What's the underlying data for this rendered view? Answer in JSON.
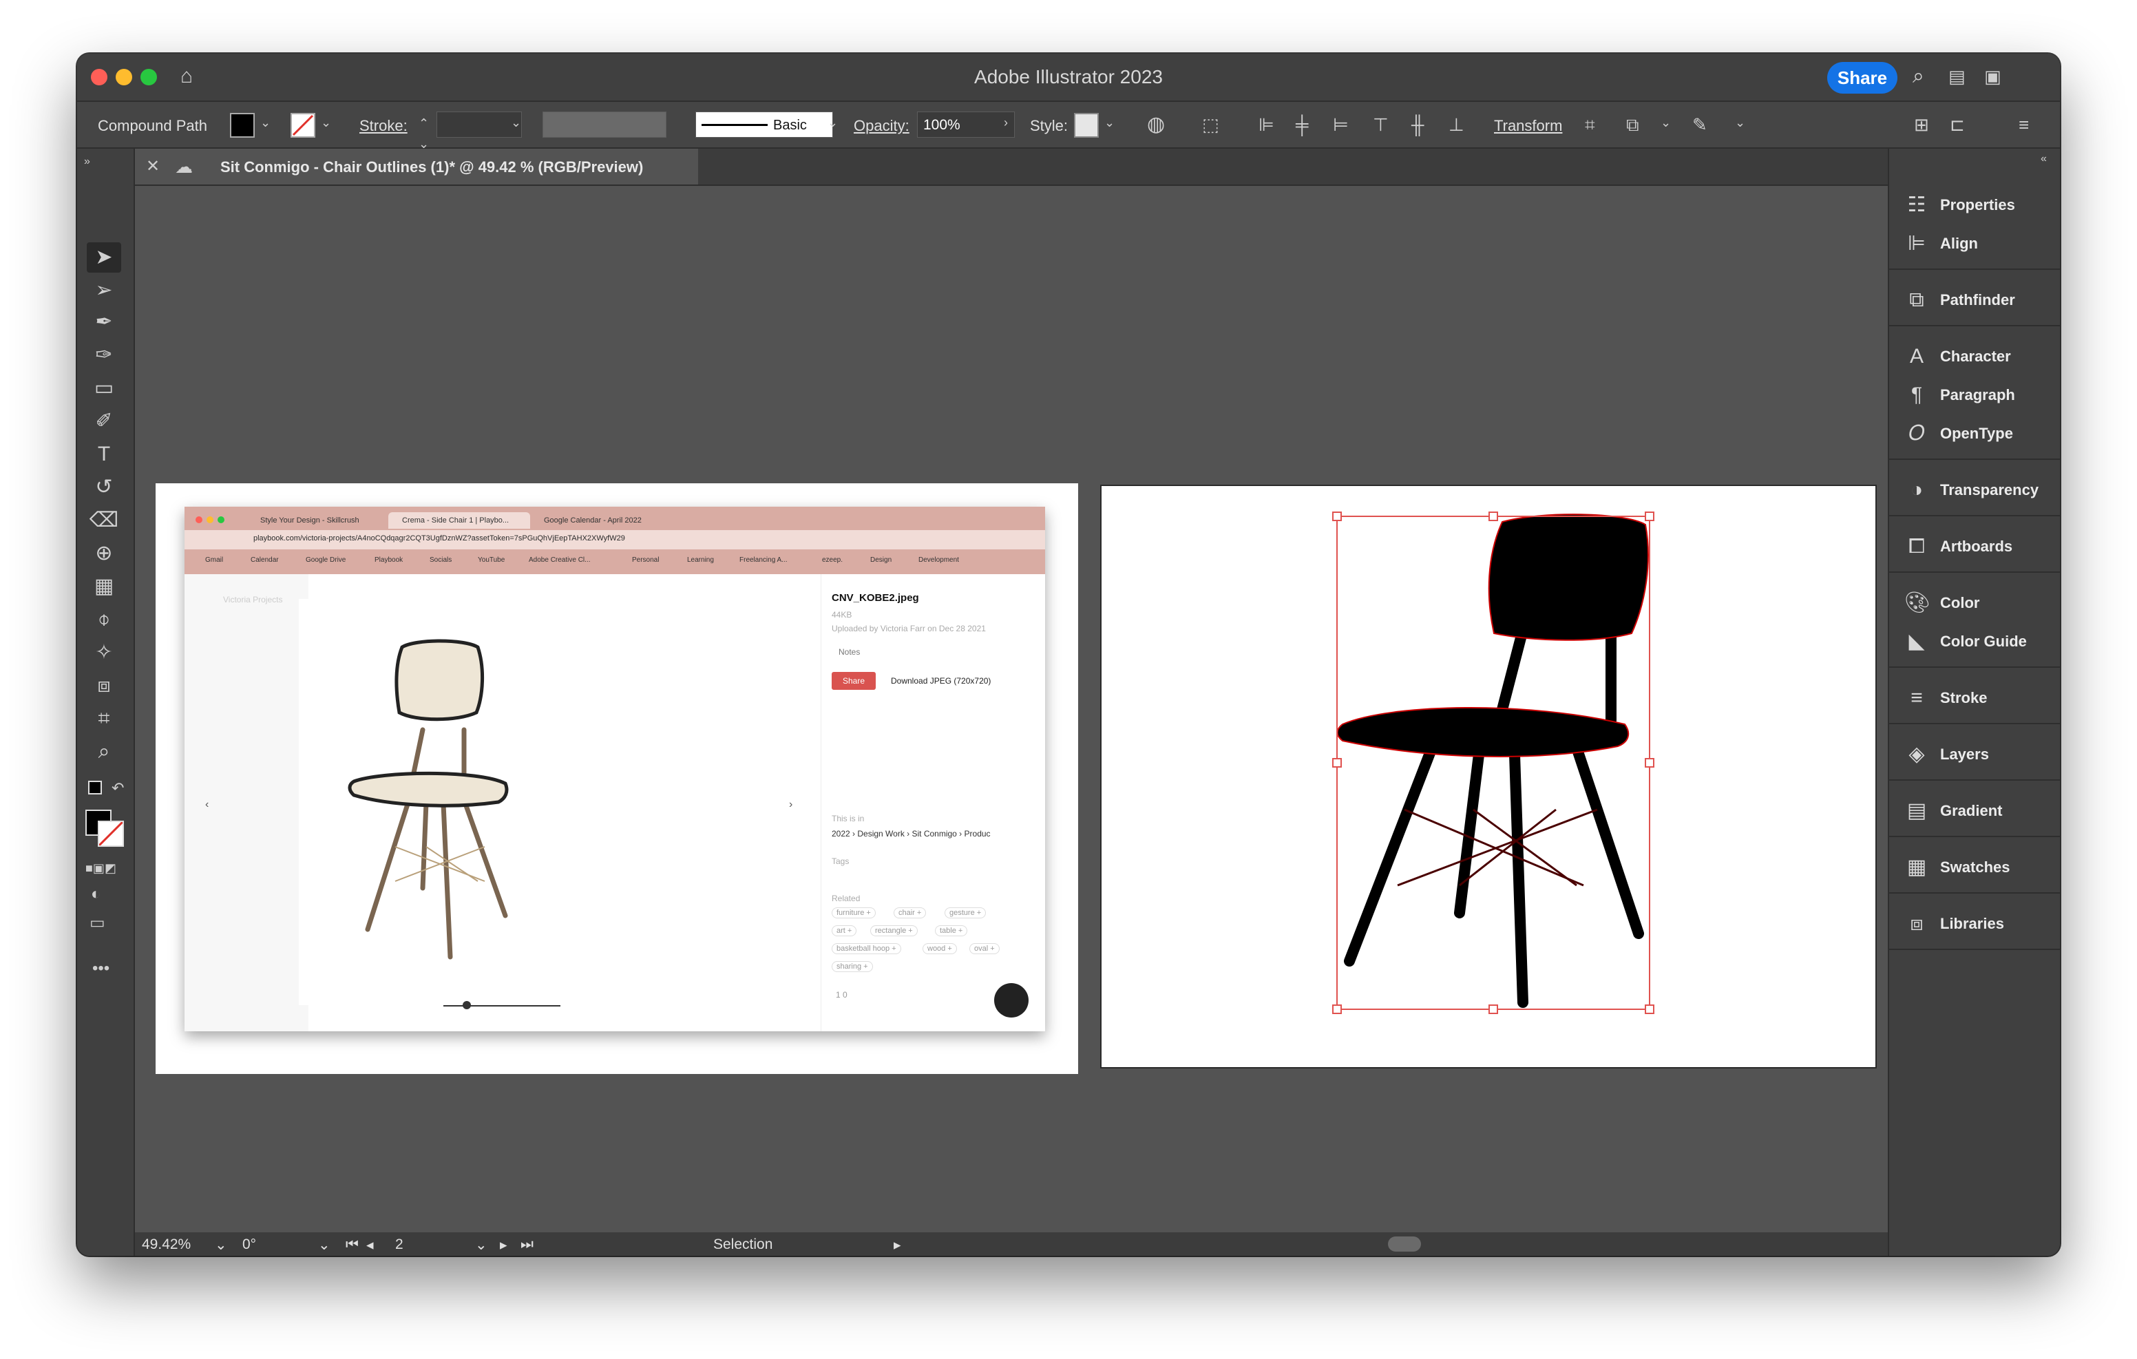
{
  "app": {
    "title": "Adobe Illustrator 2023",
    "share_label": "Share"
  },
  "control_bar": {
    "selection_type": "Compound Path",
    "stroke_label": "Stroke:",
    "brush_label": "Basic",
    "opacity_label": "Opacity:",
    "opacity_value": "100%",
    "style_label": "Style:",
    "transform_label": "Transform"
  },
  "document_tab": {
    "title": "Sit Conmigo - Chair Outlines (1)* @ 49.42 % (RGB/Preview)"
  },
  "tools": [
    "selection-tool",
    "direct-selection-tool",
    "pen-tool",
    "curvature-tool",
    "rectangle-tool",
    "paintbrush-tool",
    "type-tool",
    "rotate-tool",
    "eraser-tool",
    "shape-builder-tool",
    "gradient-tool",
    "eyedropper-tool",
    "puppet-warp-tool",
    "live-paint-tool",
    "artboard-tool",
    "zoom-tool"
  ],
  "panels": [
    {
      "label": "Properties",
      "icon": "properties-icon"
    },
    {
      "label": "Align",
      "icon": "align-icon"
    },
    {
      "label": "Pathfinder",
      "icon": "pathfinder-icon"
    },
    {
      "label": "Character",
      "icon": "character-icon"
    },
    {
      "label": "Paragraph",
      "icon": "paragraph-icon"
    },
    {
      "label": "OpenType",
      "icon": "opentype-icon"
    },
    {
      "label": "Transparency",
      "icon": "transparency-icon"
    },
    {
      "label": "Artboards",
      "icon": "artboards-icon"
    },
    {
      "label": "Color",
      "icon": "color-icon"
    },
    {
      "label": "Color Guide",
      "icon": "color-guide-icon"
    },
    {
      "label": "Stroke",
      "icon": "stroke-icon"
    },
    {
      "label": "Layers",
      "icon": "layers-icon"
    },
    {
      "label": "Gradient",
      "icon": "gradient-icon"
    },
    {
      "label": "Swatches",
      "icon": "swatches-icon"
    },
    {
      "label": "Libraries",
      "icon": "libraries-icon"
    }
  ],
  "status_bar": {
    "zoom": "49.42%",
    "rotation": "0°",
    "artboard_number": "2",
    "tool_name": "Selection"
  },
  "embedded_screenshot": {
    "tabs": [
      "Style Your Design - Skillcrush",
      "Crema - Side Chair 1 | Playbo...",
      "Google Calendar - April 2022"
    ],
    "url": "playbook.com/victoria-projects/A4noCQdqagr2CQT3UgfDznWZ?assetToken=7sPGuQhVjEepTAHX2XWyfW29",
    "bookmarks": [
      "Gmail",
      "Calendar",
      "Google Drive",
      "Playbook",
      "Socials",
      "YouTube",
      "Adobe Creative Cl...",
      "Personal",
      "Learning",
      "Freelancing A...",
      "ezeep.",
      "Design",
      "Development"
    ],
    "file_name": "CNV_KOBE2.jpeg",
    "file_size": "44KB",
    "uploaded_by": "Uploaded by Victoria Farr on Dec 28 2021",
    "notes_label": "Notes",
    "share_label": "Share",
    "download_label": "Download JPEG (720x720)",
    "this_is_in_label": "This is in",
    "path": "2022 › Design Work  ›  Sit Conmigo  ›  Produc",
    "tags_label": "Tags",
    "related_label": "Related",
    "related_tags": [
      "furniture +",
      "chair +",
      "gesture +",
      "art +",
      "rectangle +",
      "table +",
      "basketball hoop +",
      "wood +",
      "oval +",
      "sharing +"
    ],
    "counts": "1   0",
    "sidebar_title": "Victoria Projects"
  },
  "colors": {
    "accent": "#1473e6",
    "bg": "#535353",
    "panel": "#404040",
    "selection": "#e0524f"
  }
}
